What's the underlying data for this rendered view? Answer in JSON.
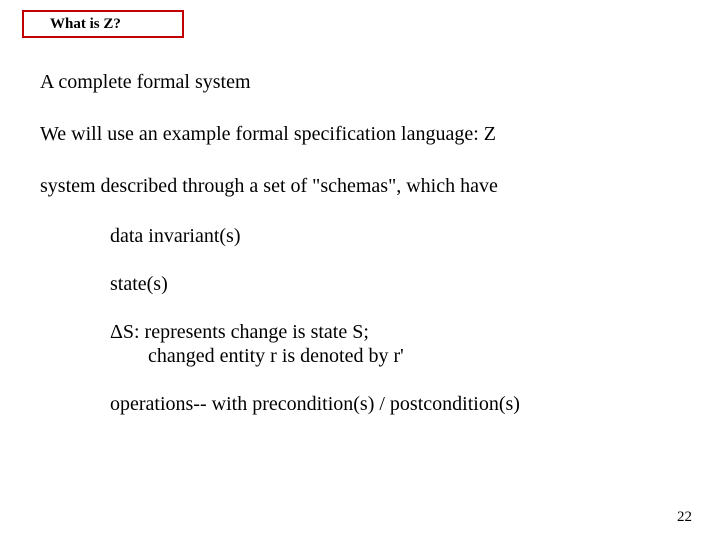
{
  "title": "What is Z?",
  "body": {
    "line1": "A complete formal system",
    "line2": "We will use an example formal specification language:  Z",
    "line3": "system described through a set of \"schemas\", which have",
    "sub1": "data invariant(s)",
    "sub2": "state(s)",
    "sub3a": "ΔS:  represents change is state S;",
    "sub3b": "changed entity r is denoted by r'",
    "sub4": "operations-- with precondition(s)  / postcondition(s)"
  },
  "pageNumber": "22"
}
